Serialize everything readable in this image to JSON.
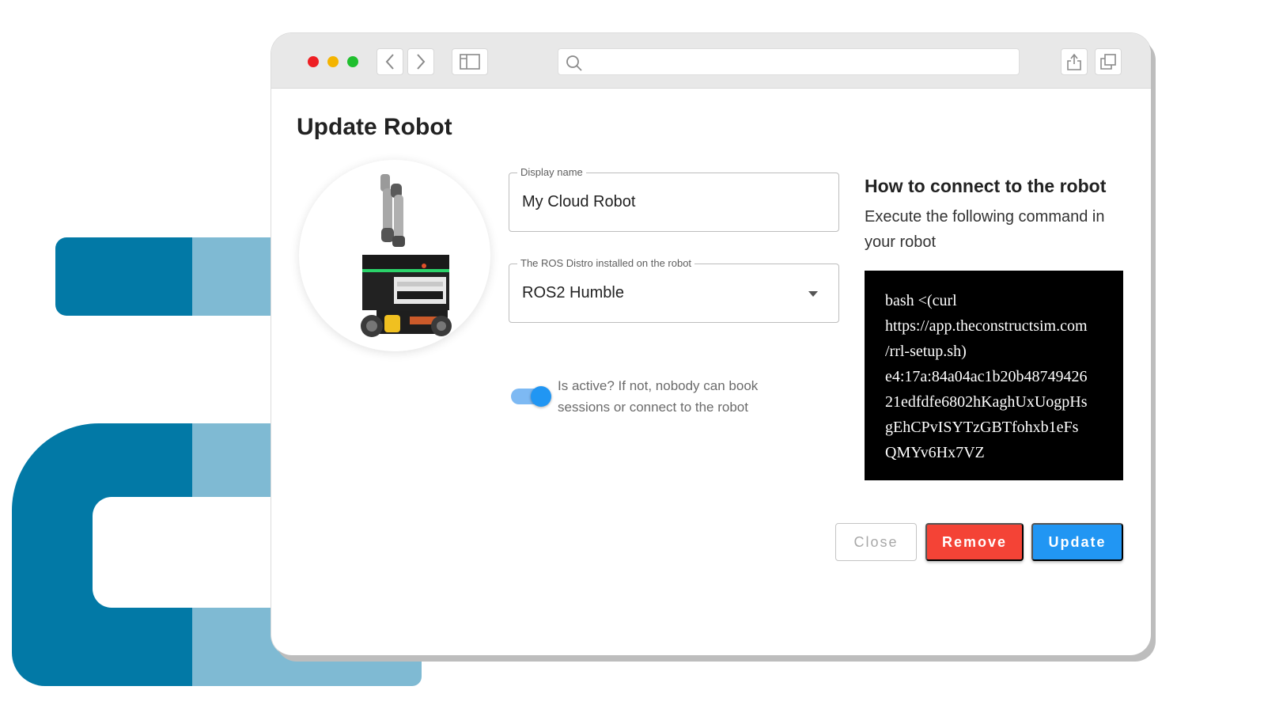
{
  "dialog": {
    "title": "Update Robot"
  },
  "form": {
    "display_name": {
      "label": "Display name",
      "value": "My Cloud Robot"
    },
    "ros_distro": {
      "label": "The ROS Distro installed on the robot",
      "value": "ROS2 Humble"
    },
    "active_toggle": {
      "checked": true,
      "label": "Is active? If not, nobody can book sessions or connect to the robot"
    }
  },
  "help": {
    "title": "How to connect to the robot",
    "text": "Execute the following command in your robot",
    "command_lines": [
      "bash <(curl",
      "https://app.theconstructsim.com",
      "/rrl-setup.sh)",
      "e4:17a:84a04ac1b20b48749426",
      "21edfdfe6802hKaghUxUogpHs",
      "gEhCPvISYTzGBTfohxb1eFs",
      "QMYv6Hx7VZ"
    ]
  },
  "buttons": {
    "close": "Close",
    "remove": "Remove",
    "update": "Update"
  },
  "colors": {
    "primary": "#2196f3",
    "danger": "#f44336",
    "brand_dark": "#0279a6",
    "brand_light": "#7fbad3"
  },
  "icons": [
    "back-icon",
    "forward-icon",
    "sidebar-icon",
    "search-icon",
    "share-icon",
    "tabs-icon",
    "dropdown-caret-icon"
  ]
}
